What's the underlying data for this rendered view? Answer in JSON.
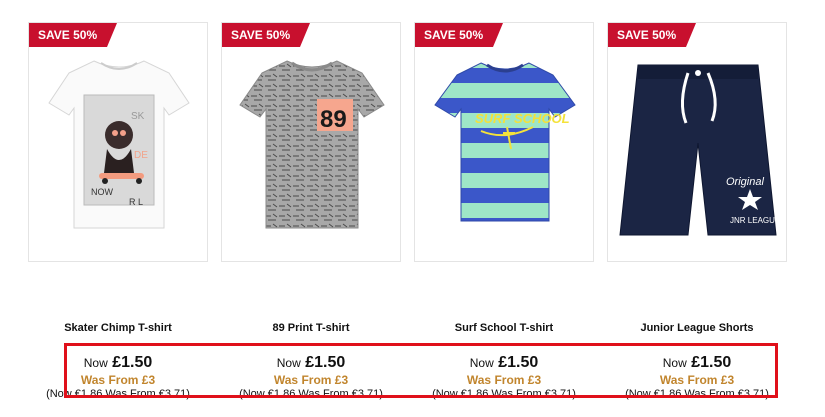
{
  "products": [
    {
      "badge": "SAVE 50%",
      "title": "Skater Chimp T-shirt",
      "now_label": "Now",
      "now_price": "£1.50",
      "was": "Was From £3",
      "euro": "(Now €1.86 Was From €3.71)"
    },
    {
      "badge": "SAVE 50%",
      "title": "89 Print T-shirt",
      "now_label": "Now",
      "now_price": "£1.50",
      "was": "Was From £3",
      "euro": "(Now €1.86 Was From €3.71)"
    },
    {
      "badge": "SAVE 50%",
      "title": "Surf School T-shirt",
      "now_label": "Now",
      "now_price": "£1.50",
      "was": "Was From £3",
      "euro": "(Now €1.86 Was From €3.71)"
    },
    {
      "badge": "SAVE 50%",
      "title": "Junior League Shorts",
      "now_label": "Now",
      "now_price": "£1.50",
      "was": "Was From £3",
      "euro": "(Now €1.86 Was From €3.71)"
    }
  ],
  "colors": {
    "badge": "#c8102e",
    "was_price": "#c1852d",
    "highlight_border": "#e0101a"
  }
}
